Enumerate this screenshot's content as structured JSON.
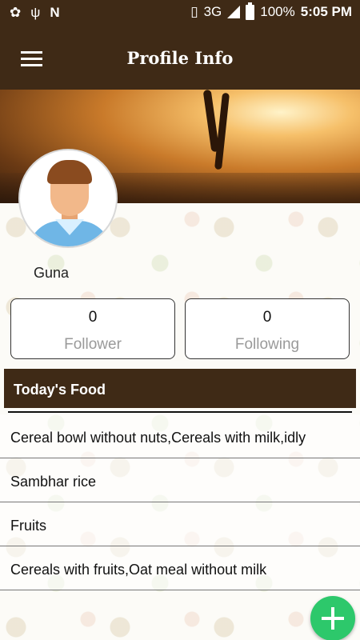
{
  "status_bar": {
    "network": "3G",
    "battery": "100%",
    "time": "5:05 PM",
    "left_icons": [
      "uc-browser-icon",
      "usb-icon",
      "n-icon"
    ]
  },
  "app_bar": {
    "title": "Profile Info",
    "menu_icon": "hamburger-menu-icon"
  },
  "profile": {
    "name": "Guna",
    "follower_count": "0",
    "follower_label": "Follower",
    "following_count": "0",
    "following_label": "Following"
  },
  "todays_food": {
    "header": "Today's Food",
    "items": [
      "Cereal bowl without nuts,Cereals with milk,idly",
      "Sambhar rice",
      "Fruits",
      "Cereals with fruits,Oat meal without milk"
    ]
  },
  "colors": {
    "brand_brown": "#3f2a16",
    "fab_green": "#2dc86b"
  }
}
